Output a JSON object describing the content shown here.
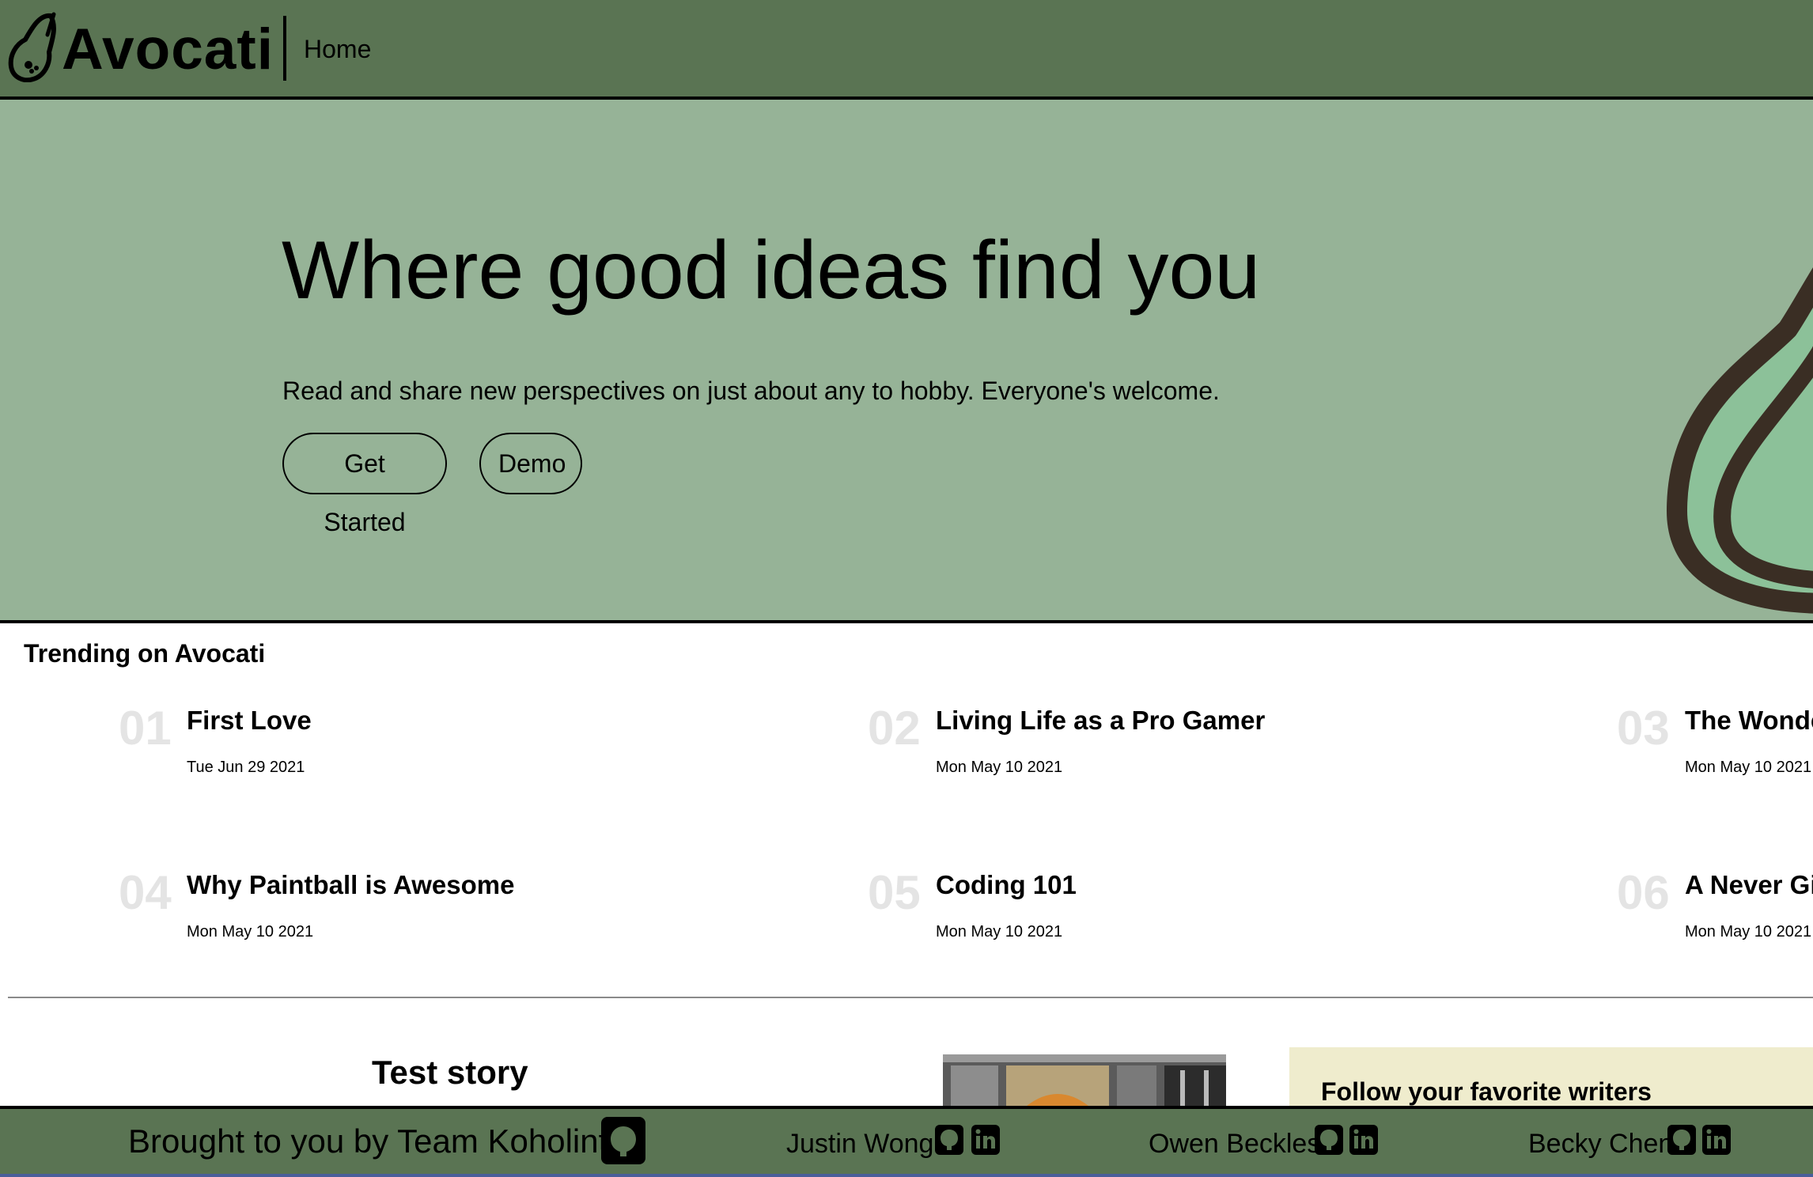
{
  "nav": {
    "brand": "Avocati",
    "home_label": "Home"
  },
  "hero": {
    "title": "Where good ideas find you",
    "subtitle": "Read and share new perspectives on just about any to hobby. Everyone's welcome.",
    "get_started_label": "Get Started",
    "demo_label": "Demo"
  },
  "trending": {
    "heading": "Trending on Avocati",
    "items": [
      {
        "num": "01",
        "title": "First Love",
        "date": "Tue Jun 29 2021"
      },
      {
        "num": "02",
        "title": "Living Life as a Pro Gamer",
        "date": "Mon May 10 2021"
      },
      {
        "num": "03",
        "title": "The Wonde",
        "date": "Mon May 10 2021"
      },
      {
        "num": "04",
        "title": "Why Paintball is Awesome",
        "date": "Mon May 10 2021"
      },
      {
        "num": "05",
        "title": "Coding 101",
        "date": "Mon May 10 2021"
      },
      {
        "num": "06",
        "title": "A Never Gi",
        "date": "Mon May 10 2021"
      }
    ]
  },
  "story": {
    "title": "Test story"
  },
  "follow": {
    "title": "Follow your favorite writers"
  },
  "footer": {
    "credit": "Brought to you by Team Koholint",
    "members": [
      "Justin Wong",
      "Owen Beckles",
      "Becky Chen"
    ]
  },
  "colors": {
    "nav_bg": "#5a7453",
    "hero_bg": "#96b397",
    "follow_bg": "#efeccd",
    "trend_num": "#e4e4e4"
  }
}
